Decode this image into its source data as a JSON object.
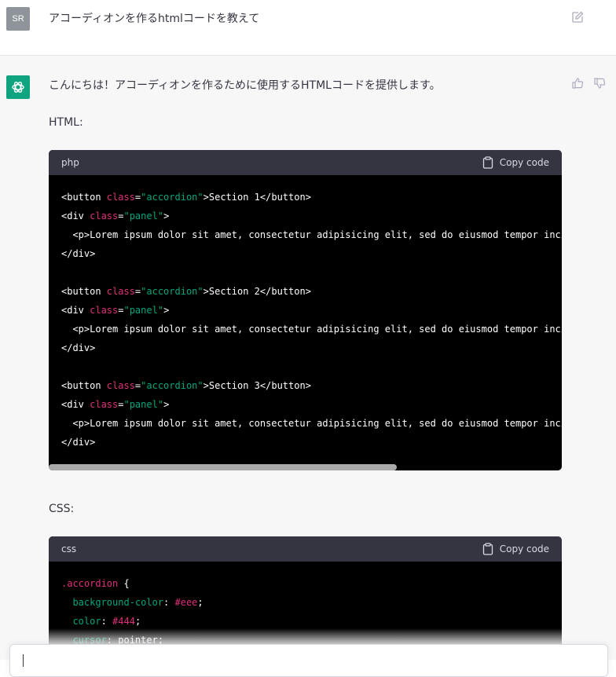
{
  "user_message": {
    "avatar_initials": "SR",
    "text": "アコーディオンを作るhtmlコードを教えて"
  },
  "assistant_message": {
    "intro": "こんにちは！アコーディオンを作るために使用するHTMLコードを提供します。",
    "html_label": "HTML:",
    "css_label": "CSS:"
  },
  "code_blocks": [
    {
      "language": "php",
      "copy_label": "Copy code"
    },
    {
      "language": "css",
      "copy_label": "Copy code"
    }
  ],
  "html_code": {
    "open_button": "<button ",
    "class_attr": "class",
    "eq": "=",
    "accordion_val": "\"accordion\"",
    "panel_val": "\"panel\"",
    "close_gt": ">",
    "button_close": "</button>",
    "div_open": "<div ",
    "div_close": "</div>",
    "p_line": "  <p>Lorem ipsum dolor sit amet, consectetur adipisicing elit, sed do eiusmod tempor incidi",
    "sections": [
      "Section 1",
      "Section 2",
      "Section 3"
    ]
  },
  "css_code": {
    "selector": ".accordion",
    "brace": " {",
    "lines": [
      {
        "prop": "  background-color",
        "value": "#eee"
      },
      {
        "prop": "  color",
        "value": "#444"
      },
      {
        "prop": "  cursor",
        "value": "pointer"
      }
    ]
  },
  "colors": {
    "accent": "#10a37f",
    "code_bg": "#000000",
    "code_header": "#343541",
    "attr": "#df3079",
    "string": "#00a67d"
  },
  "icons": [
    "edit-icon",
    "openai-logo-icon",
    "thumbs-up-icon",
    "thumbs-down-icon",
    "clipboard-icon"
  ]
}
